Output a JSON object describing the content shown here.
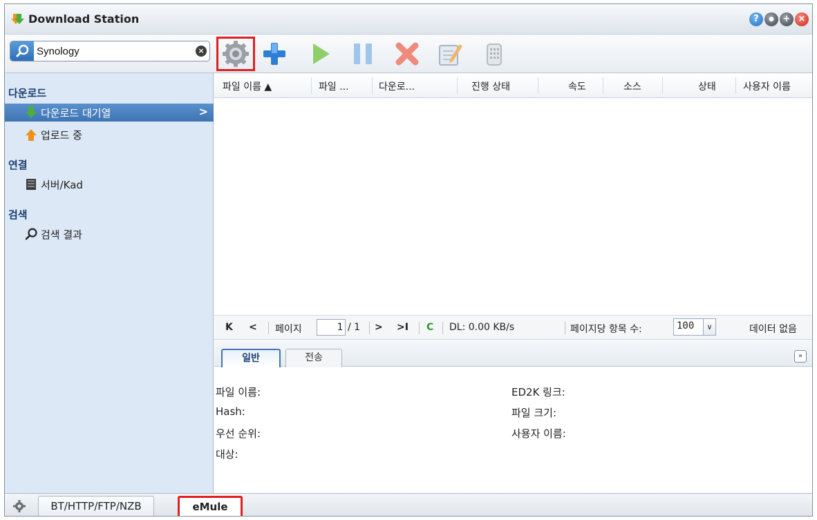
{
  "window": {
    "title": "Download Station",
    "controls": {
      "help": "?",
      "minimize": "●",
      "maximize": "+",
      "close": "×"
    }
  },
  "toolbar": {
    "search_value": "Synology",
    "search_clear": "×",
    "buttons": [
      "settings-gear-icon",
      "add-icon",
      "play-icon",
      "pause-icon",
      "delete-icon",
      "edit-icon",
      "clear-icon"
    ]
  },
  "sidebar": {
    "groups": [
      {
        "label": "다운로드",
        "items": [
          {
            "label": "다운로드 대기열",
            "icon": "download-arrow-icon",
            "selected": true,
            "chevron": ">"
          },
          {
            "label": "업로드 중",
            "icon": "upload-arrow-icon",
            "selected": false
          }
        ]
      },
      {
        "label": "연결",
        "items": [
          {
            "label": "서버/Kad",
            "icon": "server-icon",
            "selected": false
          }
        ]
      },
      {
        "label": "검색",
        "items": [
          {
            "label": "검색 결과",
            "icon": "search-icon",
            "selected": false
          }
        ]
      }
    ]
  },
  "grid": {
    "columns": [
      "파일 이름 ▲",
      "파일 ...",
      "다운로...",
      "진행 상태",
      "속도",
      "소스",
      "상태",
      "사용자 이름"
    ]
  },
  "pager": {
    "first": "K",
    "prev": "<",
    "page_label": "페이지",
    "page_value": "1",
    "page_total": "/ 1",
    "next": ">",
    "last": ">I",
    "refresh": "C",
    "dl_speed": "DL: 0.00 KB/s",
    "per_page_label": "페이지당 항목 수:",
    "per_page_value": "100",
    "dropdown_arrow": "∨",
    "no_data": "데이터 없음"
  },
  "detail": {
    "tabs": [
      "일반",
      "전송"
    ],
    "collapse": "»",
    "fields_left": [
      "파일 이름:",
      "Hash:",
      "우선 순위:",
      "대상:"
    ],
    "fields_right": [
      "ED2K 링크:",
      "파일 크기:",
      "사용자 이름:"
    ]
  },
  "bottom_tabs": [
    "BT/HTTP/FTP/NZB",
    "eMule"
  ],
  "colors": {
    "accent": "#3f74b3",
    "sidebar_bg": "#dce8f5",
    "highlight": "#e02020"
  }
}
